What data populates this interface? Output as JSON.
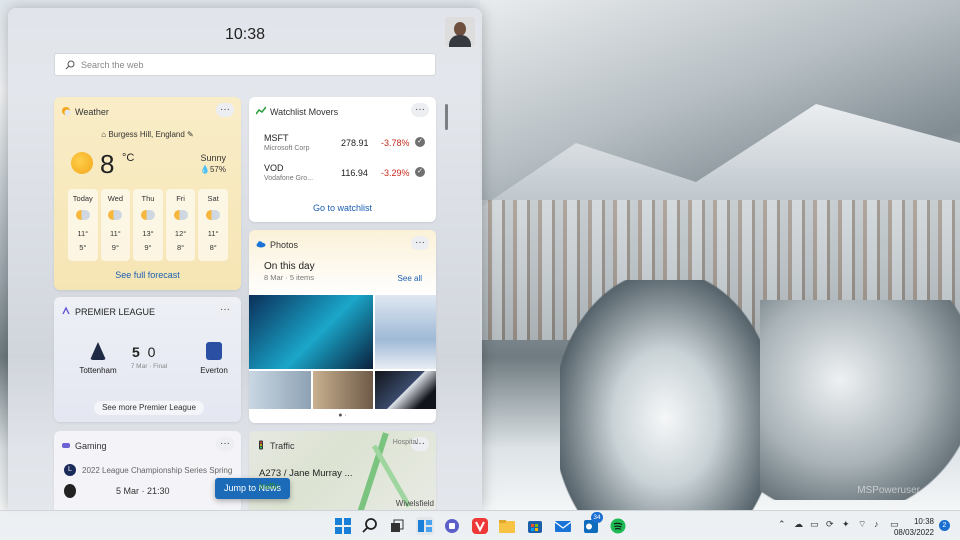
{
  "panel": {
    "clock": "10:38",
    "search_placeholder": "Search the web"
  },
  "weather": {
    "title": "Weather",
    "location": "Burgess Hill, England",
    "temperature": "8",
    "unit": "°C",
    "condition": "Sunny",
    "humidity": "57%",
    "days": [
      {
        "name": "Today",
        "high": "11°",
        "low": "5°"
      },
      {
        "name": "Wed",
        "high": "11°",
        "low": "9°"
      },
      {
        "name": "Thu",
        "high": "13°",
        "low": "9°"
      },
      {
        "name": "Fri",
        "high": "12°",
        "low": "8°"
      },
      {
        "name": "Sat",
        "high": "11°",
        "low": "8°"
      }
    ],
    "forecast_link": "See full forecast"
  },
  "premier_league": {
    "title": "PREMIER LEAGUE",
    "home": "Tottenham",
    "away": "Everton",
    "home_score": "5",
    "away_score": "0",
    "date_status": "7 Mar · Final",
    "see_more": "See more Premier League"
  },
  "gaming": {
    "title": "Gaming",
    "badge": "L",
    "event": "2022 League Championship Series Spring",
    "date_time": "5 Mar · 21:30"
  },
  "watchlist": {
    "title": "Watchlist Movers",
    "rows": [
      {
        "symbol": "MSFT",
        "company": "Microsoft Corp",
        "price": "278.91",
        "change": "-3.78%"
      },
      {
        "symbol": "VOD",
        "company": "Vodafone Gro...",
        "price": "116.94",
        "change": "-3.29%"
      }
    ],
    "link": "Go to watchlist"
  },
  "photos": {
    "title": "Photos",
    "heading": "On this day",
    "date": "8 Mar · 5 items",
    "see_all": "See all"
  },
  "traffic": {
    "title": "Traffic",
    "route": "A273 / Jane Murray ...",
    "status": "traffic",
    "place_top": "Hospital",
    "place_bottom": "Wivelsfield"
  },
  "jump_button": "Jump to News",
  "taskbar": {
    "time": "10:38",
    "date": "08/03/2022",
    "notification_count": "2",
    "store_badge": "34"
  },
  "wallpaper": {
    "watermark": "MSPoweruser"
  },
  "colors": {
    "accent": "#1a6fd1",
    "negative": "#c42b1c",
    "link": "#1a5fb4"
  }
}
